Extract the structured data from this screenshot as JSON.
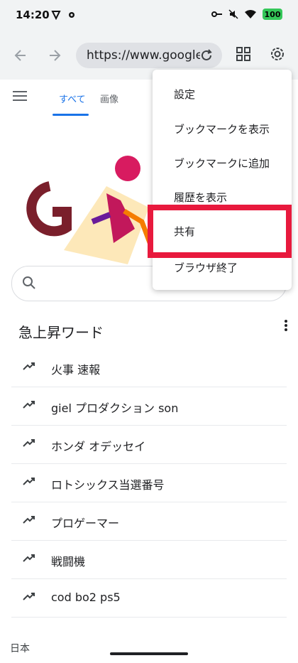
{
  "status": {
    "time": "14:20",
    "battery": "100"
  },
  "toolbar": {
    "url": "https://www.google.co.jp"
  },
  "search": {
    "tabs": [
      "すべて",
      "画像"
    ]
  },
  "trending": {
    "title": "急上昇ワード",
    "items": [
      "火事 速報",
      "giel プロダクション son",
      "ホンダ オデッセイ",
      "ロトシックス当選番号",
      "プロゲーマー",
      "戦闘機",
      "cod bo2 ps5"
    ]
  },
  "footer": {
    "text": "日本"
  },
  "menu": {
    "items": [
      "設定",
      "ブックマークを表示",
      "ブックマークに追加",
      "履歴を表示",
      "共有",
      "ブラウザ終了"
    ]
  },
  "colors": {
    "accent": "#1a73e8",
    "highlight": "#e8193d"
  }
}
